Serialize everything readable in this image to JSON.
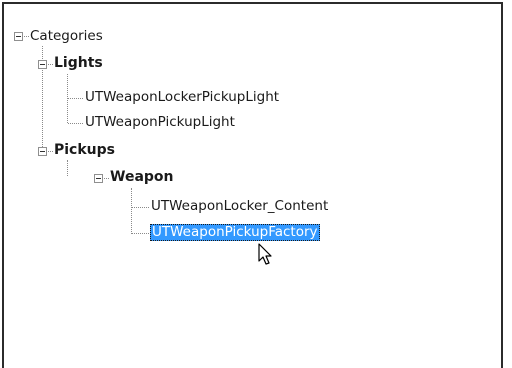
{
  "tree": {
    "root": {
      "label": "Categories",
      "expanded": true
    },
    "groups": [
      {
        "label": "Lights",
        "expanded": true,
        "items": [
          "UTWeaponLockerPickupLight",
          "UTWeaponPickupLight"
        ]
      },
      {
        "label": "Pickups",
        "expanded": true,
        "subgroups": [
          {
            "label": "Weapon",
            "expanded": true,
            "items": [
              "UTWeaponLocker_Content",
              "UTWeaponPickupFactory"
            ]
          }
        ]
      }
    ],
    "selected_item": "UTWeaponPickupFactory"
  },
  "colors": {
    "selection": "#3399ff",
    "selection_text": "#ffffff",
    "tree_lines": "#8a8a8a"
  },
  "icons": {
    "expander": "minus-box-icon",
    "pointer": "mouse-pointer-icon"
  }
}
